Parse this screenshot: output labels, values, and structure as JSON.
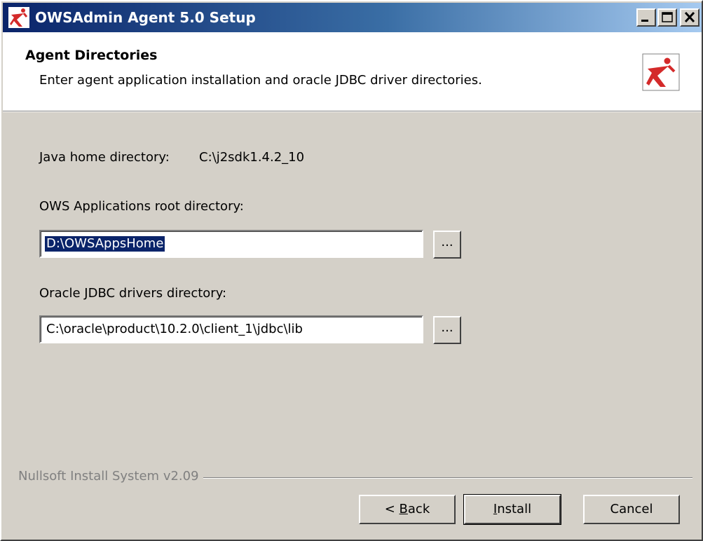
{
  "window": {
    "title": "OWSAdmin Agent 5.0 Setup"
  },
  "header": {
    "title": "Agent Directories",
    "subtitle": "Enter agent application installation and oracle JDBC driver directories."
  },
  "java": {
    "label": "Java home directory:",
    "value": "C:\\j2sdk1.4.2_10"
  },
  "ows_root": {
    "label": "OWS Applications root directory:",
    "value": "D:\\OWSAppsHome",
    "browse_label": "..."
  },
  "jdbc": {
    "label": "Oracle JDBC drivers directory:",
    "value": "C:\\oracle\\product\\10.2.0\\client_1\\jdbc\\lib",
    "browse_label": "..."
  },
  "branding": "Nullsoft Install System v2.09",
  "buttons": {
    "back": {
      "prefix": "< ",
      "mnemonic": "B",
      "rest": "ack"
    },
    "install": {
      "mnemonic": "I",
      "rest": "nstall"
    },
    "cancel": "Cancel"
  },
  "colors": {
    "titlebar_start": "#0a246a",
    "titlebar_end": "#a6caf0",
    "face": "#d4d0c8",
    "logo_red": "#d42a2a"
  }
}
